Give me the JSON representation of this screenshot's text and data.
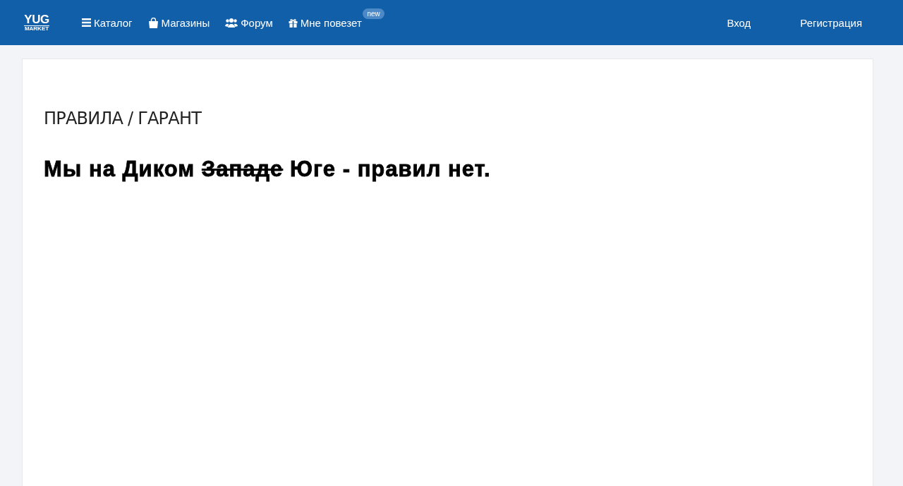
{
  "logo": {
    "line_1": "YUG",
    "line_2": "MARKET"
  },
  "nav": [
    {
      "kind": "list",
      "label": "Каталог"
    },
    {
      "kind": "bag",
      "label": "Магазины"
    },
    {
      "kind": "users",
      "label": "Форум"
    },
    {
      "kind": "gift",
      "label": "Мне повезет",
      "badge": "new"
    }
  ],
  "auth": [
    "Вход",
    "Регистрация"
  ],
  "breadcrumb": "ПРАВИЛА / ГАРАНТ",
  "heading": [
    {
      "text": "Мы на Диком ",
      "struck": false
    },
    {
      "text": "Западе",
      "struck": true
    },
    {
      "text": " Юге - правил нет.",
      "struck": false
    }
  ]
}
